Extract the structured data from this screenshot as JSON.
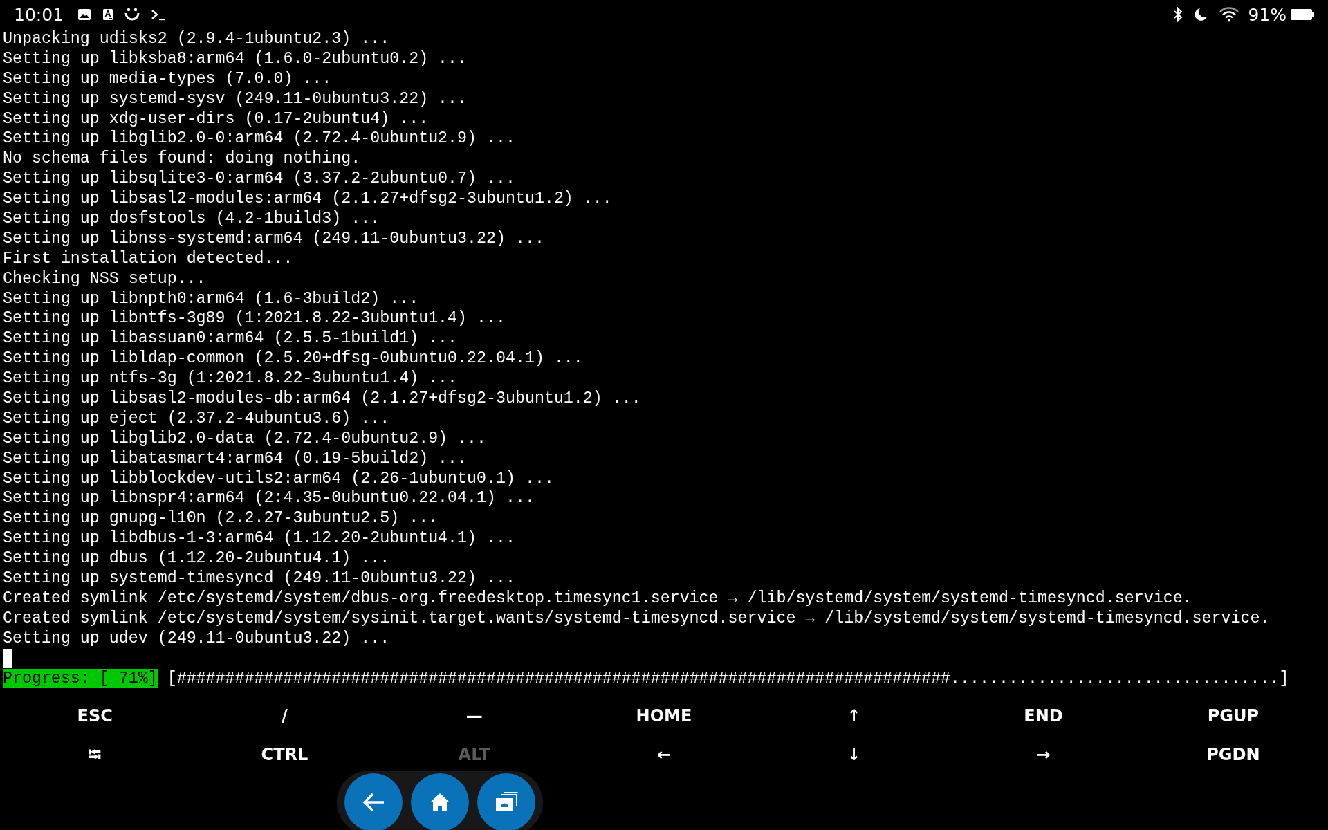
{
  "status_bar": {
    "time": "10:01",
    "battery": "91%"
  },
  "terminal": {
    "lines": [
      "Unpacking udisks2 (2.9.4-1ubuntu2.3) ...",
      "Setting up libksba8:arm64 (1.6.0-2ubuntu0.2) ...",
      "Setting up media-types (7.0.0) ...",
      "Setting up systemd-sysv (249.11-0ubuntu3.22) ...",
      "Setting up xdg-user-dirs (0.17-2ubuntu4) ...",
      "Setting up libglib2.0-0:arm64 (2.72.4-0ubuntu2.9) ...",
      "No schema files found: doing nothing.",
      "Setting up libsqlite3-0:arm64 (3.37.2-2ubuntu0.7) ...",
      "Setting up libsasl2-modules:arm64 (2.1.27+dfsg2-3ubuntu1.2) ...",
      "Setting up dosfstools (4.2-1build3) ...",
      "Setting up libnss-systemd:arm64 (249.11-0ubuntu3.22) ...",
      "First installation detected...",
      "Checking NSS setup...",
      "Setting up libnpth0:arm64 (1.6-3build2) ...",
      "Setting up libntfs-3g89 (1:2021.8.22-3ubuntu1.4) ...",
      "Setting up libassuan0:arm64 (2.5.5-1build1) ...",
      "Setting up libldap-common (2.5.20+dfsg-0ubuntu0.22.04.1) ...",
      "Setting up ntfs-3g (1:2021.8.22-3ubuntu1.4) ...",
      "Setting up libsasl2-modules-db:arm64 (2.1.27+dfsg2-3ubuntu1.2) ...",
      "Setting up eject (2.37.2-4ubuntu3.6) ...",
      "Setting up libglib2.0-data (2.72.4-0ubuntu2.9) ...",
      "Setting up libatasmart4:arm64 (0.19-5build2) ...",
      "Setting up libblockdev-utils2:arm64 (2.26-1ubuntu0.1) ...",
      "Setting up libnspr4:arm64 (2:4.35-0ubuntu0.22.04.1) ...",
      "Setting up gnupg-l10n (2.2.27-3ubuntu2.5) ...",
      "Setting up libdbus-1-3:arm64 (1.12.20-2ubuntu4.1) ...",
      "Setting up dbus (1.12.20-2ubuntu4.1) ...",
      "Setting up systemd-timesyncd (249.11-0ubuntu3.22) ...",
      "Created symlink /etc/systemd/system/dbus-org.freedesktop.timesync1.service → /lib/systemd/system/systemd-timesyncd.service.",
      "Created symlink /etc/systemd/system/sysinit.target.wants/systemd-timesyncd.service → /lib/systemd/system/systemd-timesyncd.service.",
      "Setting up udev (249.11-0ubuntu3.22) ..."
    ],
    "progress_label": "Progress: [ 71%]",
    "progress_bar": "[################################################################################..................................]"
  },
  "extra_keys": [
    {
      "label": "ESC",
      "dimmed": false
    },
    {
      "label": "/",
      "dimmed": false
    },
    {
      "label": "—",
      "dimmed": false
    },
    {
      "label": "HOME",
      "dimmed": false
    },
    {
      "label": "↑",
      "dimmed": false
    },
    {
      "label": "END",
      "dimmed": false
    },
    {
      "label": "PGUP",
      "dimmed": false
    },
    {
      "label": "⭾",
      "dimmed": false
    },
    {
      "label": "CTRL",
      "dimmed": false
    },
    {
      "label": "ALT",
      "dimmed": true
    },
    {
      "label": "←",
      "dimmed": false
    },
    {
      "label": "↓",
      "dimmed": false
    },
    {
      "label": "→",
      "dimmed": false
    },
    {
      "label": "PGDN",
      "dimmed": false
    }
  ]
}
